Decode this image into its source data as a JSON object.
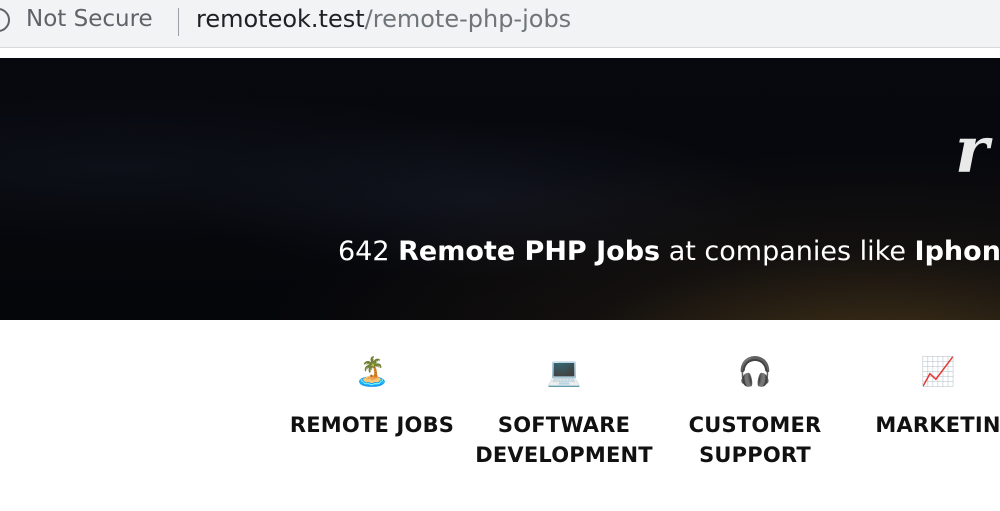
{
  "browser": {
    "security_text": "Not Secure",
    "url_domain": "remoteok.test",
    "url_path": "/remote-php-jobs",
    "security_icon": "info-circle-icon"
  },
  "hero": {
    "logo_text": "r",
    "count": "642",
    "title": "Remote PHP Jobs",
    "middle": "at companies like",
    "company": "Iphone"
  },
  "categories": [
    {
      "icon": "island-icon",
      "emoji": "🏝️",
      "line1": "REMOTE JOBS",
      "line2": ""
    },
    {
      "icon": "laptop-icon",
      "emoji": "💻",
      "line1": "SOFTWARE",
      "line2": "DEVELOPMENT"
    },
    {
      "icon": "headphones-icon",
      "emoji": "🎧",
      "line1": "CUSTOMER",
      "line2": "SUPPORT"
    },
    {
      "icon": "chart-increasing-icon",
      "emoji": "📈",
      "line1": "MARKETIN",
      "line2": ""
    }
  ]
}
